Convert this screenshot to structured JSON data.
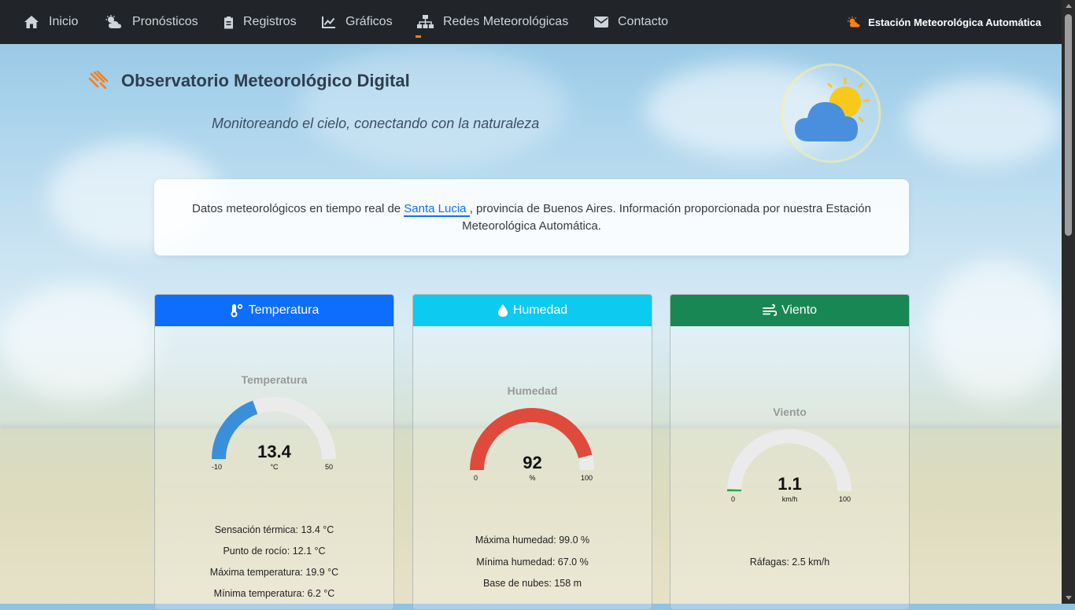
{
  "nav": {
    "items": [
      {
        "label": "Inicio",
        "icon": "home-icon"
      },
      {
        "label": "Pronósticos",
        "icon": "cloud-sun-icon"
      },
      {
        "label": "Registros",
        "icon": "clipboard-icon"
      },
      {
        "label": "Gráficos",
        "icon": "chart-line-icon"
      },
      {
        "label": "Redes Meteorológicas",
        "icon": "network-icon"
      },
      {
        "label": "Contacto",
        "icon": "envelope-icon"
      }
    ],
    "brand": "Estación Meteorológica Automática",
    "brand_icon": "sun-cloud-icon",
    "accent": "#fd7e14"
  },
  "header": {
    "title": "Observatorio Meteorológico Digital",
    "subtitle": "Monitoreando el cielo, conectando con la naturaleza"
  },
  "intro": {
    "text_before": "Datos meteorológicos en tiempo real de ",
    "link": "Santa Lucia ",
    "text_after": ", provincia de Buenos Aires. Información proporcionada por nuestra Estación Meteorológica Automática."
  },
  "cards": {
    "temperature": {
      "header": "Temperatura",
      "color": "#0d6efd",
      "gauge": {
        "title": "Temperatura",
        "value": "13.4",
        "unit": "°C",
        "min": "-10",
        "max": "50",
        "fraction": 0.39,
        "color": "#3a8fd9"
      },
      "stats": [
        "Sensación térmica: 13.4 °C",
        "Punto de rocío: 12.1 °C",
        "Máxima temperatura: 19.9 °C",
        "Mínima temperatura: 6.2 °C"
      ]
    },
    "humidity": {
      "header": "Humedad",
      "color": "#0dcaf0",
      "gauge": {
        "title": "Humedad",
        "value": "92",
        "unit": "%",
        "min": "0",
        "max": "100",
        "fraction": 0.92,
        "color": "#e04a3c"
      },
      "stats": [
        "Máxima humedad: 99.0 %",
        "Mínima humedad: 67.0 %",
        "Base de nubes: 158 m"
      ]
    },
    "wind": {
      "header": "Viento",
      "color": "#198754",
      "gauge": {
        "title": "Viento",
        "value": "1.1",
        "unit": "km/h",
        "min": "0",
        "max": "100",
        "fraction": 0.011,
        "color": "#28a745"
      },
      "stats": [
        "Ráfagas: 2.5 km/h"
      ]
    }
  }
}
